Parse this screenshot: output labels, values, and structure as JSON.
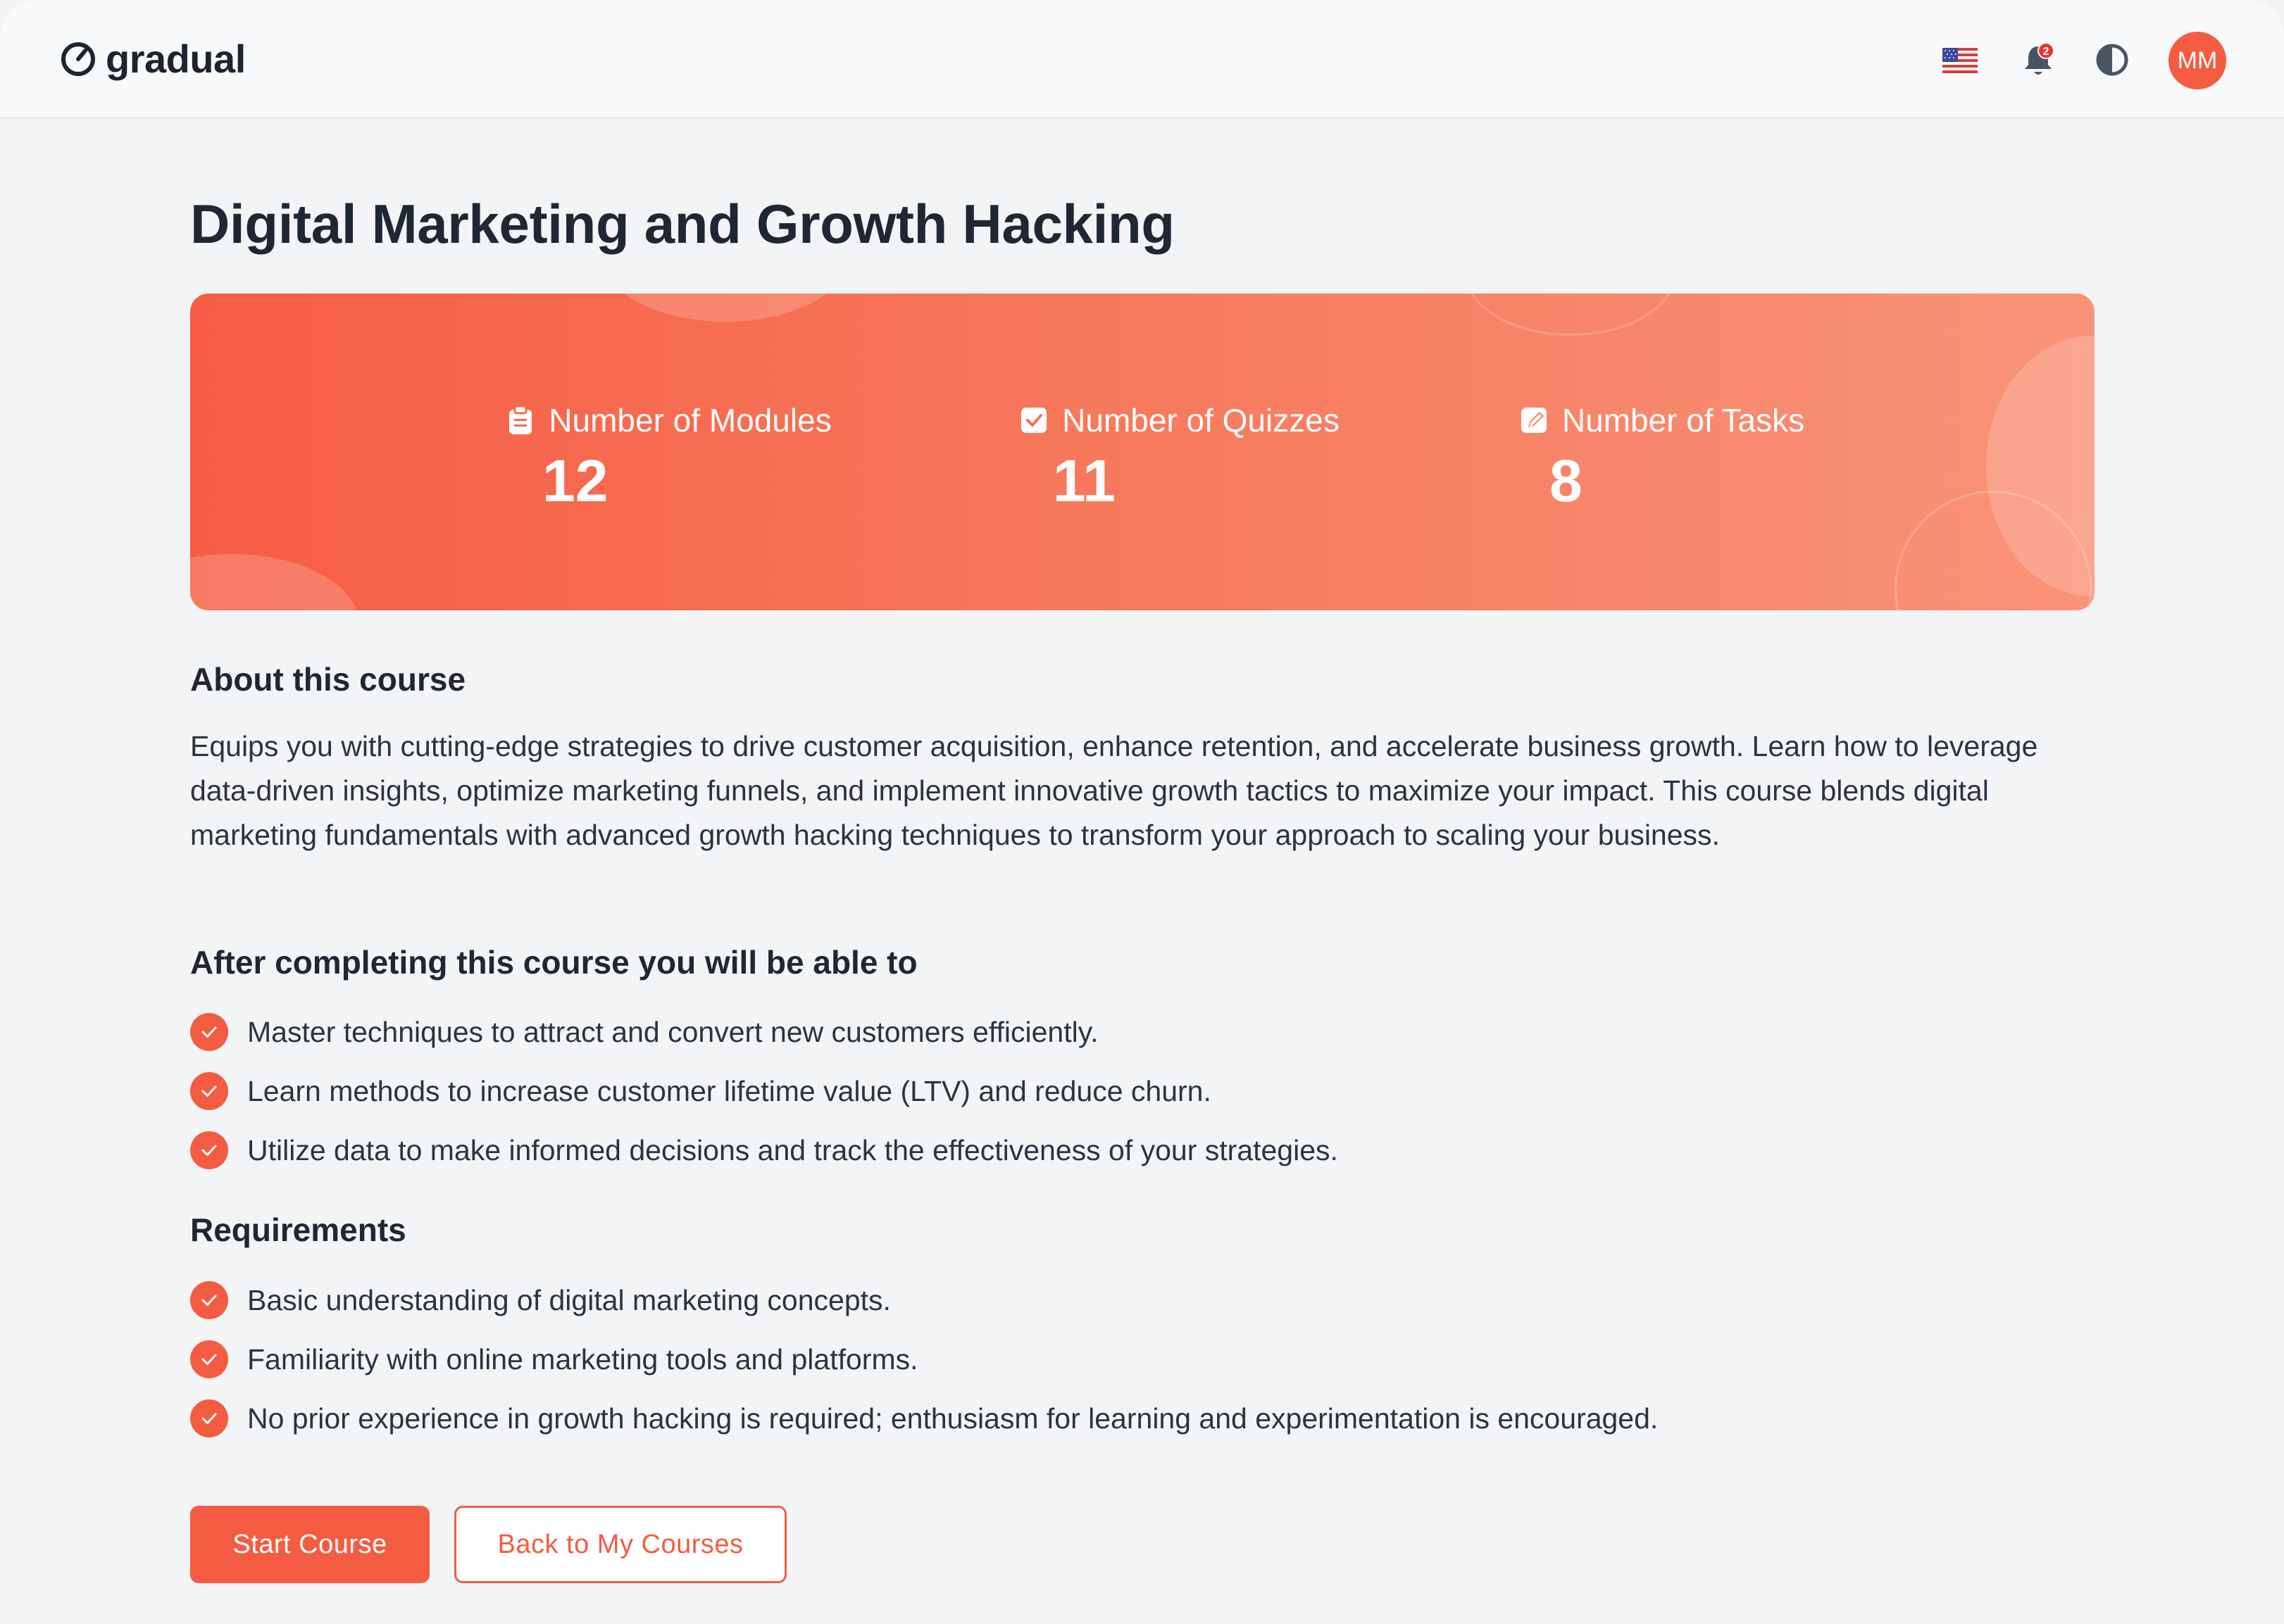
{
  "app": {
    "name": "gradual"
  },
  "header": {
    "language": "English (US)",
    "notification_count": "2",
    "avatar_initials": "MM"
  },
  "course": {
    "title": "Digital Marketing and Growth Hacking",
    "stats": {
      "modules_label": "Number of Modules",
      "modules_value": "12",
      "quizzes_label": "Number of Quizzes",
      "quizzes_value": "11",
      "tasks_label": "Number of Tasks",
      "tasks_value": "8"
    },
    "about_heading": "About this course",
    "about_text": "Equips you with cutting-edge strategies to drive customer acquisition, enhance retention, and accelerate business growth. Learn how to leverage data-driven insights, optimize marketing funnels, and implement innovative growth tactics to maximize your impact. This course blends digital marketing fundamentals with advanced growth hacking techniques to transform your approach to scaling your business.",
    "outcomes_heading": "After completing this course you will be able to",
    "outcomes": [
      "Master techniques to attract and convert new customers efficiently.",
      "Learn methods to increase customer lifetime value (LTV) and reduce churn.",
      "Utilize data to make informed decisions and track the effectiveness of your strategies."
    ],
    "requirements_heading": "Requirements",
    "requirements": [
      "Basic understanding of digital marketing concepts.",
      "Familiarity with online marketing tools and platforms.",
      "No prior experience in growth hacking is required; enthusiasm for learning and experimentation is encouraged."
    ]
  },
  "actions": {
    "start_label": "Start Course",
    "back_label": "Back to My Courses"
  },
  "colors": {
    "accent": "#f45c42",
    "banner_start": "#f65d44",
    "banner_end": "#f99378",
    "badge": "#e5352b"
  },
  "icons": {
    "logo": "gauge-icon",
    "flag": "us-flag-icon",
    "bell": "bell-icon",
    "theme": "contrast-icon",
    "modules": "clipboard-icon",
    "quizzes": "checkbox-icon",
    "tasks": "edit-icon",
    "check": "check-circle-icon"
  }
}
